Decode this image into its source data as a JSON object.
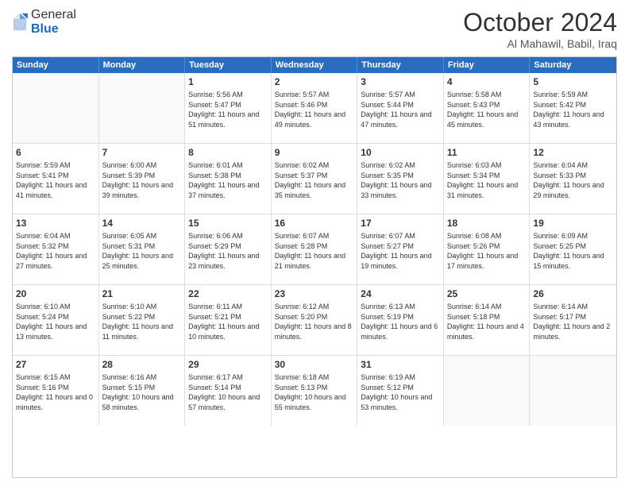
{
  "header": {
    "logo_general": "General",
    "logo_blue": "Blue",
    "month": "October 2024",
    "location": "Al Mahawil, Babil, Iraq"
  },
  "weekdays": [
    "Sunday",
    "Monday",
    "Tuesday",
    "Wednesday",
    "Thursday",
    "Friday",
    "Saturday"
  ],
  "rows": [
    [
      {
        "day": "",
        "sunrise": "",
        "sunset": "",
        "daylight": ""
      },
      {
        "day": "",
        "sunrise": "",
        "sunset": "",
        "daylight": ""
      },
      {
        "day": "1",
        "sunrise": "Sunrise: 5:56 AM",
        "sunset": "Sunset: 5:47 PM",
        "daylight": "Daylight: 11 hours and 51 minutes."
      },
      {
        "day": "2",
        "sunrise": "Sunrise: 5:57 AM",
        "sunset": "Sunset: 5:46 PM",
        "daylight": "Daylight: 11 hours and 49 minutes."
      },
      {
        "day": "3",
        "sunrise": "Sunrise: 5:57 AM",
        "sunset": "Sunset: 5:44 PM",
        "daylight": "Daylight: 11 hours and 47 minutes."
      },
      {
        "day": "4",
        "sunrise": "Sunrise: 5:58 AM",
        "sunset": "Sunset: 5:43 PM",
        "daylight": "Daylight: 11 hours and 45 minutes."
      },
      {
        "day": "5",
        "sunrise": "Sunrise: 5:59 AM",
        "sunset": "Sunset: 5:42 PM",
        "daylight": "Daylight: 11 hours and 43 minutes."
      }
    ],
    [
      {
        "day": "6",
        "sunrise": "Sunrise: 5:59 AM",
        "sunset": "Sunset: 5:41 PM",
        "daylight": "Daylight: 11 hours and 41 minutes."
      },
      {
        "day": "7",
        "sunrise": "Sunrise: 6:00 AM",
        "sunset": "Sunset: 5:39 PM",
        "daylight": "Daylight: 11 hours and 39 minutes."
      },
      {
        "day": "8",
        "sunrise": "Sunrise: 6:01 AM",
        "sunset": "Sunset: 5:38 PM",
        "daylight": "Daylight: 11 hours and 37 minutes."
      },
      {
        "day": "9",
        "sunrise": "Sunrise: 6:02 AM",
        "sunset": "Sunset: 5:37 PM",
        "daylight": "Daylight: 11 hours and 35 minutes."
      },
      {
        "day": "10",
        "sunrise": "Sunrise: 6:02 AM",
        "sunset": "Sunset: 5:35 PM",
        "daylight": "Daylight: 11 hours and 33 minutes."
      },
      {
        "day": "11",
        "sunrise": "Sunrise: 6:03 AM",
        "sunset": "Sunset: 5:34 PM",
        "daylight": "Daylight: 11 hours and 31 minutes."
      },
      {
        "day": "12",
        "sunrise": "Sunrise: 6:04 AM",
        "sunset": "Sunset: 5:33 PM",
        "daylight": "Daylight: 11 hours and 29 minutes."
      }
    ],
    [
      {
        "day": "13",
        "sunrise": "Sunrise: 6:04 AM",
        "sunset": "Sunset: 5:32 PM",
        "daylight": "Daylight: 11 hours and 27 minutes."
      },
      {
        "day": "14",
        "sunrise": "Sunrise: 6:05 AM",
        "sunset": "Sunset: 5:31 PM",
        "daylight": "Daylight: 11 hours and 25 minutes."
      },
      {
        "day": "15",
        "sunrise": "Sunrise: 6:06 AM",
        "sunset": "Sunset: 5:29 PM",
        "daylight": "Daylight: 11 hours and 23 minutes."
      },
      {
        "day": "16",
        "sunrise": "Sunrise: 6:07 AM",
        "sunset": "Sunset: 5:28 PM",
        "daylight": "Daylight: 11 hours and 21 minutes."
      },
      {
        "day": "17",
        "sunrise": "Sunrise: 6:07 AM",
        "sunset": "Sunset: 5:27 PM",
        "daylight": "Daylight: 11 hours and 19 minutes."
      },
      {
        "day": "18",
        "sunrise": "Sunrise: 6:08 AM",
        "sunset": "Sunset: 5:26 PM",
        "daylight": "Daylight: 11 hours and 17 minutes."
      },
      {
        "day": "19",
        "sunrise": "Sunrise: 6:09 AM",
        "sunset": "Sunset: 5:25 PM",
        "daylight": "Daylight: 11 hours and 15 minutes."
      }
    ],
    [
      {
        "day": "20",
        "sunrise": "Sunrise: 6:10 AM",
        "sunset": "Sunset: 5:24 PM",
        "daylight": "Daylight: 11 hours and 13 minutes."
      },
      {
        "day": "21",
        "sunrise": "Sunrise: 6:10 AM",
        "sunset": "Sunset: 5:22 PM",
        "daylight": "Daylight: 11 hours and 11 minutes."
      },
      {
        "day": "22",
        "sunrise": "Sunrise: 6:11 AM",
        "sunset": "Sunset: 5:21 PM",
        "daylight": "Daylight: 11 hours and 10 minutes."
      },
      {
        "day": "23",
        "sunrise": "Sunrise: 6:12 AM",
        "sunset": "Sunset: 5:20 PM",
        "daylight": "Daylight: 11 hours and 8 minutes."
      },
      {
        "day": "24",
        "sunrise": "Sunrise: 6:13 AM",
        "sunset": "Sunset: 5:19 PM",
        "daylight": "Daylight: 11 hours and 6 minutes."
      },
      {
        "day": "25",
        "sunrise": "Sunrise: 6:14 AM",
        "sunset": "Sunset: 5:18 PM",
        "daylight": "Daylight: 11 hours and 4 minutes."
      },
      {
        "day": "26",
        "sunrise": "Sunrise: 6:14 AM",
        "sunset": "Sunset: 5:17 PM",
        "daylight": "Daylight: 11 hours and 2 minutes."
      }
    ],
    [
      {
        "day": "27",
        "sunrise": "Sunrise: 6:15 AM",
        "sunset": "Sunset: 5:16 PM",
        "daylight": "Daylight: 11 hours and 0 minutes."
      },
      {
        "day": "28",
        "sunrise": "Sunrise: 6:16 AM",
        "sunset": "Sunset: 5:15 PM",
        "daylight": "Daylight: 10 hours and 58 minutes."
      },
      {
        "day": "29",
        "sunrise": "Sunrise: 6:17 AM",
        "sunset": "Sunset: 5:14 PM",
        "daylight": "Daylight: 10 hours and 57 minutes."
      },
      {
        "day": "30",
        "sunrise": "Sunrise: 6:18 AM",
        "sunset": "Sunset: 5:13 PM",
        "daylight": "Daylight: 10 hours and 55 minutes."
      },
      {
        "day": "31",
        "sunrise": "Sunrise: 6:19 AM",
        "sunset": "Sunset: 5:12 PM",
        "daylight": "Daylight: 10 hours and 53 minutes."
      },
      {
        "day": "",
        "sunrise": "",
        "sunset": "",
        "daylight": ""
      },
      {
        "day": "",
        "sunrise": "",
        "sunset": "",
        "daylight": ""
      }
    ]
  ]
}
